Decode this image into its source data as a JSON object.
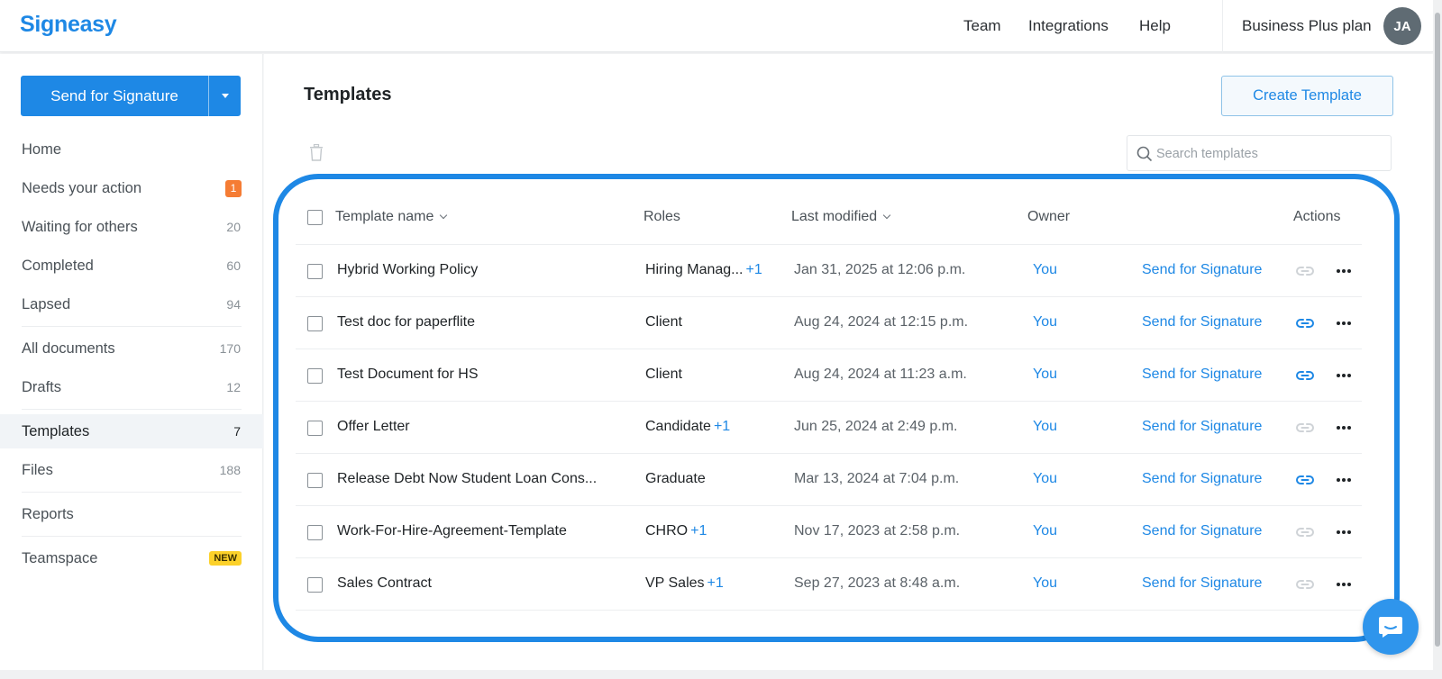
{
  "app": {
    "logo": "Signeasy",
    "nav": [
      "Team",
      "Integrations",
      "Help"
    ],
    "plan": "Business Plus plan",
    "avatar_initials": "JA",
    "accent": "#1e88e5"
  },
  "sidebar": {
    "send_button": "Send for Signature",
    "items": [
      {
        "label": "Home",
        "count": ""
      },
      {
        "label": "Needs your action",
        "badge": "1"
      },
      {
        "label": "Waiting for others",
        "count": "20"
      },
      {
        "label": "Completed",
        "count": "60"
      },
      {
        "label": "Lapsed",
        "count": "94"
      },
      {
        "label": "All documents",
        "count": "170"
      },
      {
        "label": "Drafts",
        "count": "12"
      },
      {
        "label": "Templates",
        "count": "7"
      },
      {
        "label": "Files",
        "count": "188"
      },
      {
        "label": "Reports",
        "count": ""
      },
      {
        "label": "Teamspace",
        "badge": "NEW"
      }
    ],
    "active": "Templates"
  },
  "main": {
    "title": "Templates",
    "create_button": "Create Template",
    "search_placeholder": "Search templates",
    "columns": {
      "name": "Template name",
      "roles": "Roles",
      "modified": "Last modified",
      "owner": "Owner",
      "actions": "Actions"
    },
    "rows": [
      {
        "name": "Hybrid Working Policy",
        "role": "Hiring Manag...",
        "role_extra": "+1",
        "modified": "Jan 31, 2025 at 12:06 p.m.",
        "owner": "You",
        "action": "Send for Signature",
        "link_active": false
      },
      {
        "name": "Test doc for paperflite",
        "role": "Client",
        "role_extra": "",
        "modified": "Aug 24, 2024 at 12:15 p.m.",
        "owner": "You",
        "action": "Send for Signature",
        "link_active": true
      },
      {
        "name": "Test Document for HS",
        "role": "Client",
        "role_extra": "",
        "modified": "Aug 24, 2024 at 11:23 a.m.",
        "owner": "You",
        "action": "Send for Signature",
        "link_active": true
      },
      {
        "name": "Offer Letter",
        "role": "Candidate",
        "role_extra": "+1",
        "modified": "Jun 25, 2024 at 2:49 p.m.",
        "owner": "You",
        "action": "Send for Signature",
        "link_active": false
      },
      {
        "name": "Release Debt Now Student Loan Cons...",
        "role": "Graduate",
        "role_extra": "",
        "modified": "Mar 13, 2024 at 7:04 p.m.",
        "owner": "You",
        "action": "Send for Signature",
        "link_active": true
      },
      {
        "name": "Work-For-Hire-Agreement-Template",
        "role": "CHRO",
        "role_extra": "+1",
        "modified": "Nov 17, 2023 at 2:58 p.m.",
        "owner": "You",
        "action": "Send for Signature",
        "link_active": false
      },
      {
        "name": "Sales Contract",
        "role": "VP Sales",
        "role_extra": "+1",
        "modified": "Sep 27, 2023 at 8:48 a.m.",
        "owner": "You",
        "action": "Send for Signature",
        "link_active": false
      }
    ]
  }
}
